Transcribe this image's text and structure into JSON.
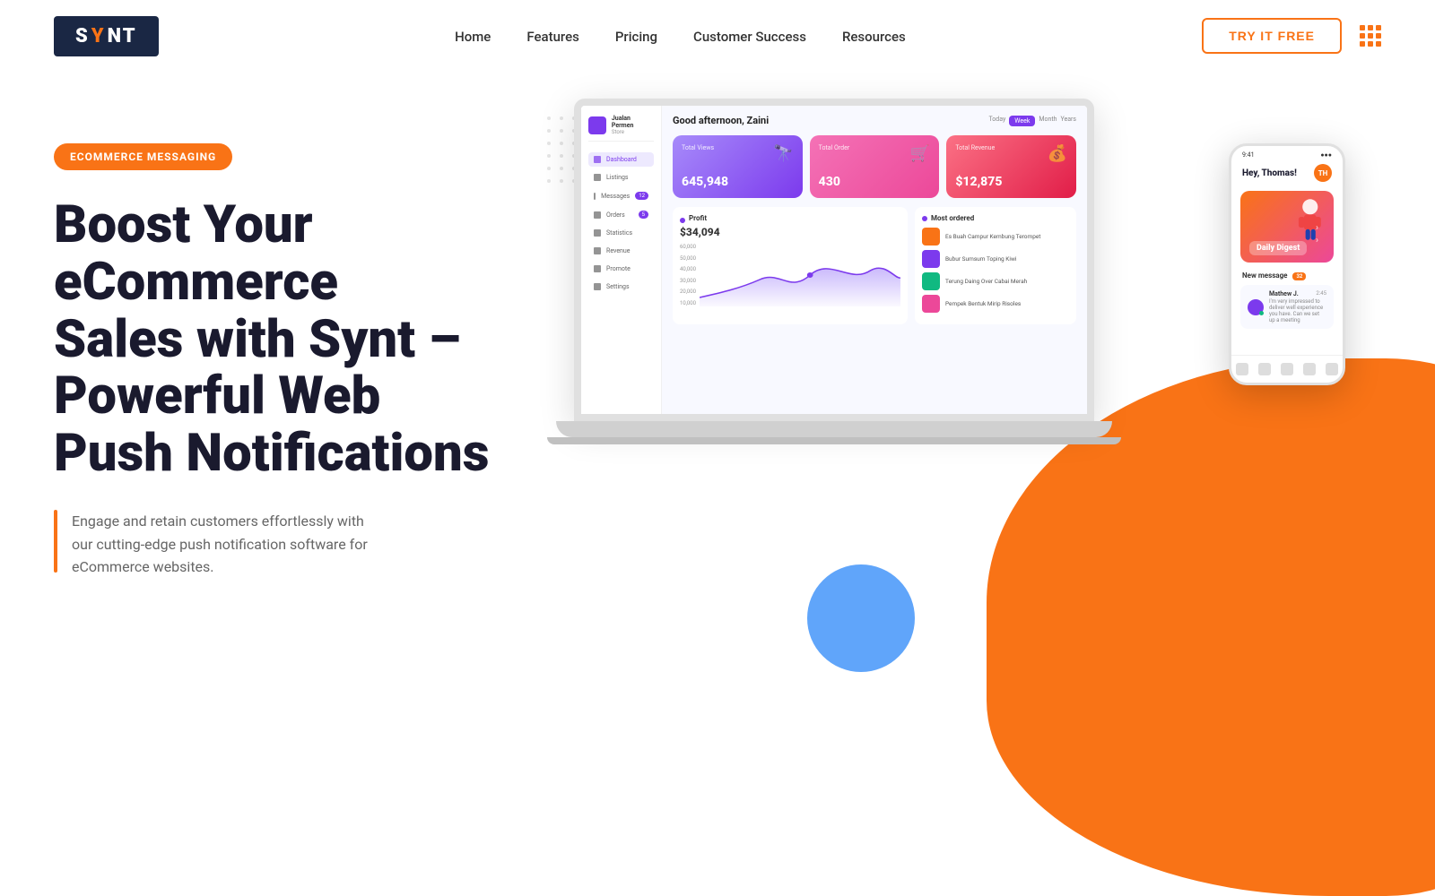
{
  "nav": {
    "logo_text": "SYNT",
    "links": [
      "Home",
      "Features",
      "Pricing",
      "Customer Success",
      "Resources"
    ],
    "cta": "TRY IT FREE"
  },
  "hero": {
    "badge": "ECOMMERCE MESSAGING",
    "title_line1": "Boost Your",
    "title_line2": "eCommerce",
    "title_line3": "Sales with Synt –",
    "title_line4": "Powerful Web",
    "title_line5": "Push Notifications",
    "description": "Engage and retain customers effortlessly with our cutting-edge push notification software for eCommerce websites."
  },
  "dashboard": {
    "user_name": "Jualan Permen",
    "greeting": "Good afternoon, Zaini",
    "time_tabs": [
      "Today",
      "Week",
      "Month",
      "Years"
    ],
    "active_tab": "Week",
    "sidebar_items": [
      {
        "label": "Dashboard",
        "active": true
      },
      {
        "label": "Listings"
      },
      {
        "label": "Messages",
        "badge": "12"
      },
      {
        "label": "Orders",
        "badge": "5"
      },
      {
        "label": "Statistics"
      },
      {
        "label": "Revenue"
      },
      {
        "label": "Promote"
      },
      {
        "label": "Settings"
      }
    ],
    "cards": [
      {
        "label": "Total Views",
        "value": "645,948",
        "type": "purple"
      },
      {
        "label": "Total Order",
        "value": "430",
        "type": "pink"
      },
      {
        "label": "Total Revenue",
        "value": "$12,875",
        "type": "red"
      }
    ],
    "chart": {
      "title": "Profit",
      "amount": "$34,094",
      "y_labels": [
        "60,000",
        "50,000",
        "40,000",
        "30,000",
        "20,000",
        "10,000"
      ]
    },
    "most_ordered": {
      "title": "Most ordered",
      "items": [
        {
          "name": "Es Buah Campur Kembung Terompet",
          "color": "#f97316"
        },
        {
          "name": "Bubur Sumsum Toping Kiwi",
          "color": "#7c3aed"
        },
        {
          "name": "Terung Daing Over Cabai Merah",
          "color": "#10b981"
        },
        {
          "name": "Pempek Bentuk Mirip Risoles",
          "color": "#ec4899"
        }
      ]
    }
  },
  "phone": {
    "time": "9:41",
    "greeting": "Hey, Thomas!",
    "avatar_initials": "TH",
    "banner_label": "Daily Digest",
    "section_new_message": "New message",
    "message_badge": "32",
    "contact_name": "Mathew J.",
    "contact_status": "online",
    "message_time": "2:45",
    "message_preview": "I'm very impressed to deliver well experience you have. Can we set up a meeting"
  },
  "colors": {
    "orange": "#f97316",
    "purple": "#7c3aed",
    "navy": "#1a2744",
    "blue": "#60a5fa"
  }
}
